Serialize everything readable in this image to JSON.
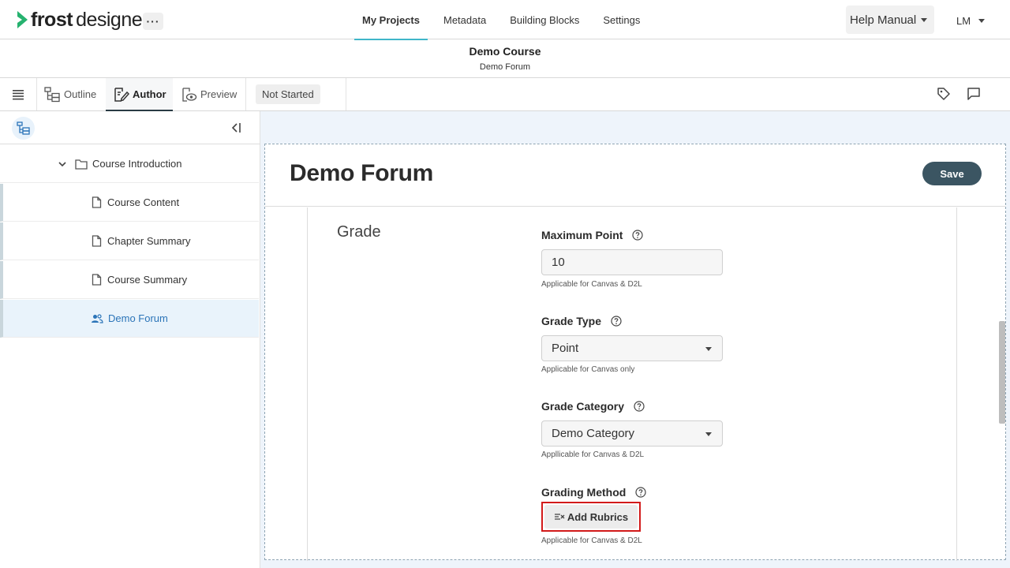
{
  "app": {
    "brand_bold": "frost",
    "brand_light": "designer",
    "more_label": "···",
    "accent_color": "#3fb6c9",
    "logo_color": "#26b26f"
  },
  "nav": {
    "links": [
      "My Projects",
      "Metadata",
      "Building Blocks",
      "Settings"
    ],
    "active": "My Projects",
    "help_label": "Help Manual",
    "user_label": "LM"
  },
  "course": {
    "title": "Demo Course",
    "subtitle": "Demo Forum"
  },
  "toolbar": {
    "tabs": [
      "Outline",
      "Author",
      "Preview"
    ],
    "active_tab": "Author",
    "status": "Not Started",
    "icons": [
      "tag-icon",
      "comment-icon"
    ]
  },
  "sidebar": {
    "items": [
      {
        "label": "Course Introduction",
        "icon": "folder-icon",
        "type": "folder",
        "expanded": true
      },
      {
        "label": "Course Content",
        "icon": "document-icon",
        "type": "page"
      },
      {
        "label": "Chapter Summary",
        "icon": "document-icon",
        "type": "page"
      },
      {
        "label": "Course Summary",
        "icon": "document-icon",
        "type": "page"
      },
      {
        "label": "Demo Forum",
        "icon": "people-icon",
        "type": "forum",
        "selected": true
      }
    ]
  },
  "editor": {
    "title": "Demo Forum",
    "save_label": "Save",
    "section": "Grade",
    "fields": {
      "max_point": {
        "label": "Maximum Point",
        "value": "10",
        "help": "Applicable for Canvas & D2L"
      },
      "grade_type": {
        "label": "Grade Type",
        "value": "Point",
        "help": "Applicable for Canvas only"
      },
      "grade_category": {
        "label": "Grade Category",
        "value": "Demo Category",
        "help": "Appllicable for Canvas & D2L"
      },
      "grading_method": {
        "label": "Grading Method",
        "button": "Add Rubrics",
        "help": "Applicable for Canvas & D2L"
      }
    }
  }
}
